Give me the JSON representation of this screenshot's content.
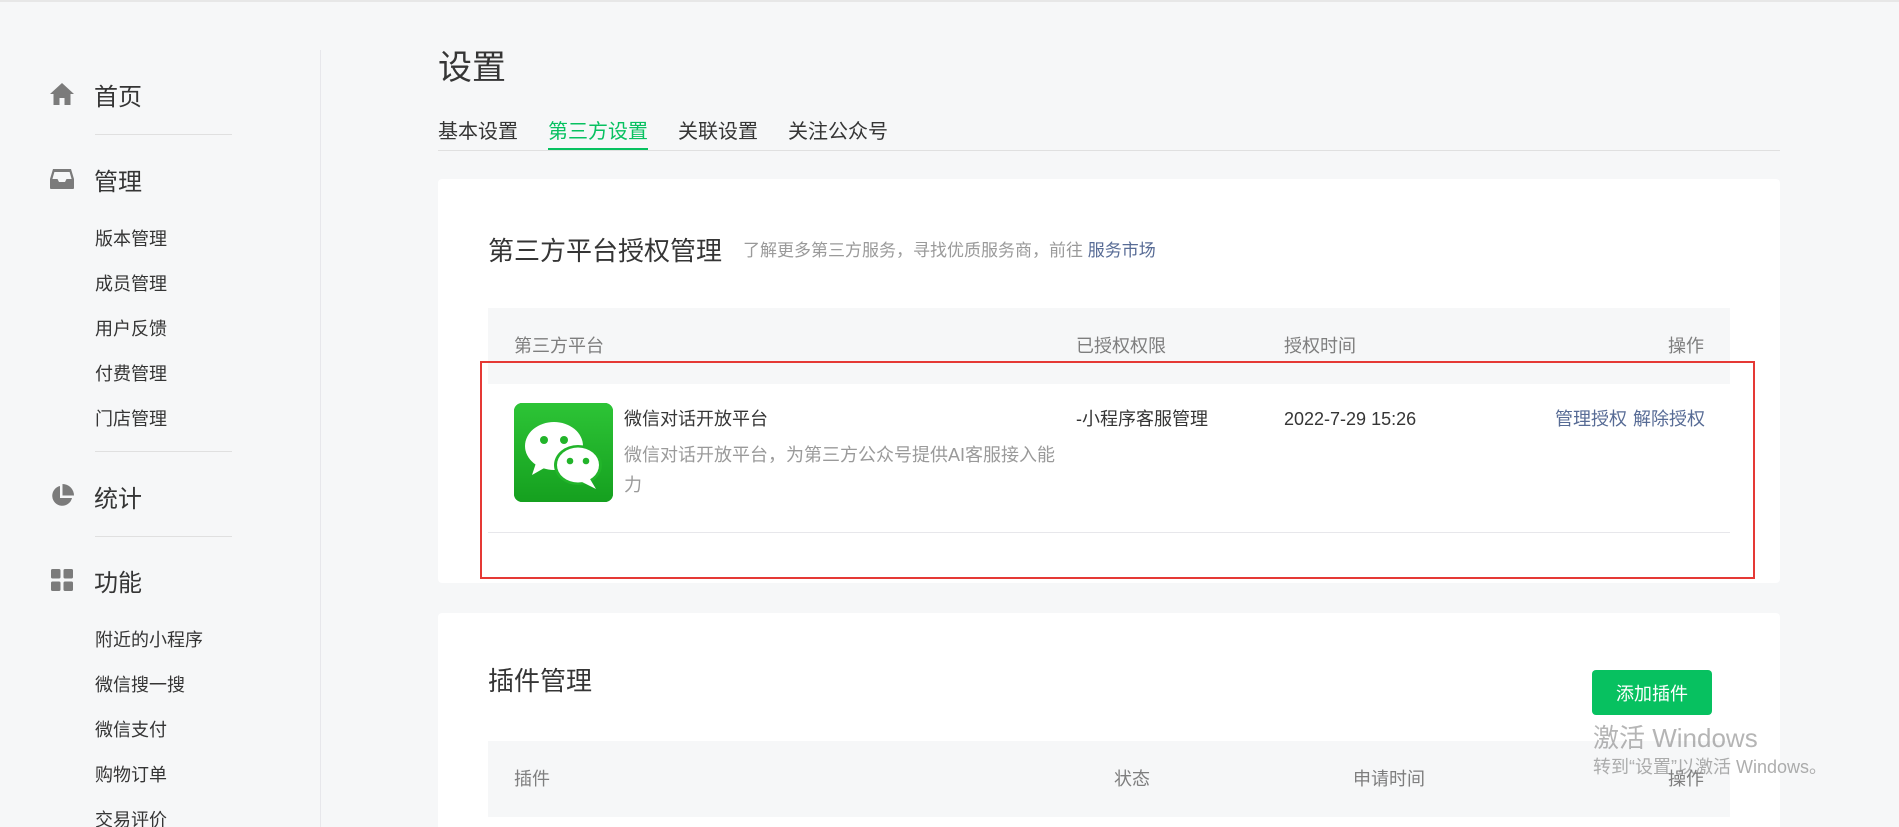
{
  "sidebar": {
    "groups": [
      {
        "label": "首页",
        "icon": "home-icon"
      },
      {
        "label": "管理",
        "icon": "inbox-icon",
        "items": [
          "版本管理",
          "成员管理",
          "用户反馈",
          "付费管理",
          "门店管理"
        ]
      },
      {
        "label": "统计",
        "icon": "pie-chart-icon"
      },
      {
        "label": "功能",
        "icon": "grid-icon",
        "items": [
          "附近的小程序",
          "微信搜一搜",
          "微信支付",
          "购物订单",
          "交易评价"
        ]
      }
    ]
  },
  "header": {
    "title": "设置",
    "tabs": [
      {
        "label": "基本设置",
        "active": false
      },
      {
        "label": "第三方设置",
        "active": true
      },
      {
        "label": "关联设置",
        "active": false
      },
      {
        "label": "关注公众号",
        "active": false
      }
    ]
  },
  "third_party": {
    "title": "第三方平台授权管理",
    "desc_prefix": "了解更多第三方服务，寻找优质服务商，前往",
    "desc_link": "服务市场",
    "columns": [
      "第三方平台",
      "已授权权限",
      "授权时间",
      "操作"
    ],
    "rows": [
      {
        "name": "微信对话开放平台",
        "desc": "微信对话开放平台，为第三方公众号提供AI客服接入能力",
        "permission": "-小程序客服管理",
        "time": "2022-7-29 15:26",
        "actions": [
          "管理授权",
          "解除授权"
        ],
        "logo": "wechat-logo-icon"
      }
    ]
  },
  "plugins": {
    "title": "插件管理",
    "add_button": "添加插件",
    "columns": [
      "插件",
      "状态",
      "申请时间",
      "操作"
    ]
  },
  "watermark": {
    "title": "激活 Windows",
    "subtitle": "转到“设置”以激活 Windows。"
  },
  "colors": {
    "accent": "#07c160",
    "link": "#576b95",
    "highlight": "#e53935"
  }
}
